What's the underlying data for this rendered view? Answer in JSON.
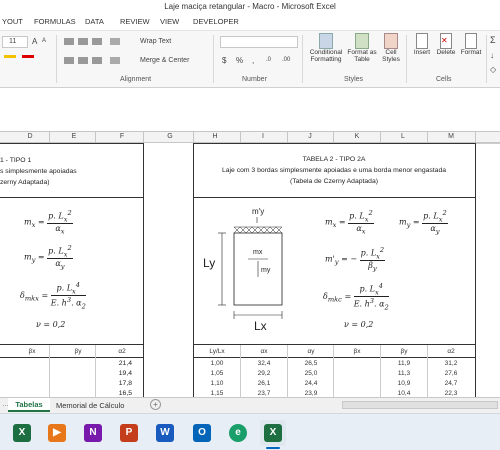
{
  "window": {
    "title": "Laje maciça retangular - Macro - Microsoft Excel"
  },
  "ribbon_tabs": [
    "YOUT",
    "FORMULAS",
    "DATA",
    "REVIEW",
    "VIEW",
    "DEVELOPER"
  ],
  "ribbon": {
    "font_size": "11",
    "wrap_text": "Wrap Text",
    "merge_center": "Merge & Center",
    "groups": {
      "alignment": "Alignment",
      "number": "Number",
      "styles": "Styles",
      "cells": "Cells"
    },
    "buttons": {
      "conditional": "Conditional",
      "formatting": "Formatting",
      "format_as": "Format as",
      "table": "Table",
      "cell": "Cell",
      "styles": "Styles",
      "insert": "Insert",
      "delete": "Delete",
      "format": "Format"
    }
  },
  "columns": [
    "D",
    "E",
    "F",
    "G",
    "H",
    "I",
    "J",
    "K",
    "L",
    "M"
  ],
  "left_block": {
    "caption1": "1 - TIPO 1",
    "caption2": "s simplesmente apoiadas",
    "caption3": "zerny Adaptada)",
    "nu": "ν = 0,2",
    "table_headers": [
      "βx",
      "βy",
      "α2"
    ],
    "rows": [
      "21,4",
      "19,4",
      "17,8",
      "16,5"
    ]
  },
  "right_block": {
    "caption1": "TABELA 2 - TIPO 2A",
    "caption2": "Laje com 3 bordas simplesmente apoiadas e uma borda menor engastada",
    "caption3": "(Tabela de Czerny Adaptada)",
    "fig_top_label": "m'y",
    "fig_mx": "mx",
    "fig_my": "my",
    "fig_ly": "Ly",
    "fig_lx": "Lx",
    "nu": "ν = 0,2",
    "table_headers": [
      "Ly/Lx",
      "αx",
      "αy",
      "βx",
      "βy",
      "α2"
    ],
    "rows": [
      [
        "1,00",
        "32,4",
        "26,5",
        "",
        "11,9",
        "31,2"
      ],
      [
        "1,05",
        "29,2",
        "25,0",
        "",
        "11,3",
        "27,6"
      ],
      [
        "1,10",
        "26,1",
        "24,4",
        "",
        "10,9",
        "24,7"
      ],
      [
        "1,15",
        "23,7",
        "23,9",
        "",
        "10,4",
        "22,3"
      ]
    ]
  },
  "sheet_tabs": [
    "Tabelas",
    "Memorial de Cálculo"
  ],
  "taskbar": [
    "X",
    "▶",
    "N",
    "P",
    "W",
    "O",
    "e",
    "X"
  ],
  "colors": {
    "excel_green": "#217346",
    "tab_active": "#ffffff"
  }
}
